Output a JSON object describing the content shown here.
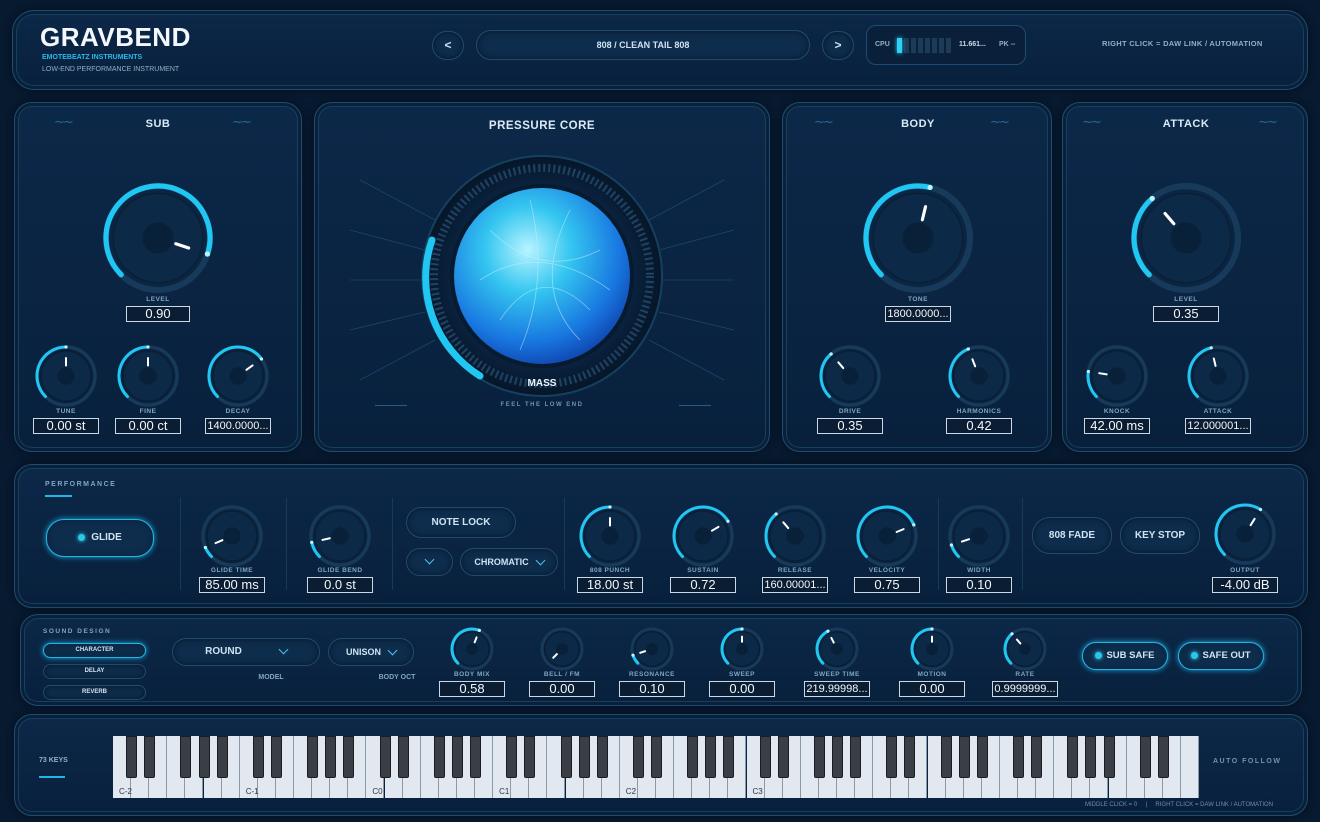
{
  "header": {
    "title": "GRAVBEND",
    "brand": "EMOTEBEATZ INSTRUMENTS",
    "tagline": "LOW-END PERFORMANCE INSTRUMENT",
    "prev_label": "<",
    "next_label": ">",
    "preset": "808  /  CLEAN TAIL 808",
    "cpu_label": "CPU",
    "cpu_value": "11.661...",
    "pk_label": "PK --",
    "hint": "RIGHT CLICK = DAW LINK / AUTOMATION"
  },
  "sub": {
    "title": "SUB",
    "level_label": "LEVEL",
    "level_value": "0.90",
    "tune_label": "TUNE",
    "tune_value": "0.00 st",
    "fine_label": "FINE",
    "fine_value": "0.00 ct",
    "decay_label": "DECAY",
    "decay_value": "1400.0000..."
  },
  "core": {
    "title": "PRESSURE CORE",
    "mass_label": "MASS",
    "subtitle": "FEEL THE LOW END"
  },
  "body": {
    "title": "BODY",
    "tone_label": "TONE",
    "tone_value": "1800.0000...",
    "drive_label": "DRIVE",
    "drive_value": "0.35",
    "harm_label": "HARMONICS",
    "harm_value": "0.42"
  },
  "attack": {
    "title": "ATTACK",
    "level_label": "LEVEL",
    "level_value": "0.35",
    "knock_label": "KNOCK",
    "knock_value": "42.00 ms",
    "attack_label": "ATTACK",
    "attack_value": "12.000001..."
  },
  "performance": {
    "title": "PERFORMANCE",
    "glide_label": "GLIDE",
    "glide_time_label": "GLIDE TIME",
    "glide_time_value": "85.00 ms",
    "glide_bend_label": "GLIDE BEND",
    "glide_bend_value": "0.0 st",
    "note_lock_label": "NOTE LOCK",
    "scale_label": "CHROMATIC",
    "punch_label": "808 PUNCH",
    "punch_value": "18.00 st",
    "sustain_label": "SUSTAIN",
    "sustain_value": "0.72",
    "release_label": "RELEASE",
    "release_value": "160.00001...",
    "velocity_label": "VELOCITY",
    "velocity_value": "0.75",
    "width_label": "WIDTH",
    "width_value": "0.10",
    "fade_label": "808 FADE",
    "keystop_label": "KEY STOP",
    "output_label": "OUTPUT",
    "output_value": "-4.00 dB"
  },
  "sound_design": {
    "title": "SOUND DESIGN",
    "tabs": [
      "CHARACTER",
      "DELAY",
      "REVERB"
    ],
    "model_value": "ROUND",
    "model_label": "MODEL",
    "bodyoct_value": "UNISON",
    "bodyoct_label": "BODY OCT",
    "body_mix_label": "BODY MIX",
    "body_mix_value": "0.58",
    "bell_label": "BELL / FM",
    "bell_value": "0.00",
    "res_label": "RESONANCE",
    "res_value": "0.10",
    "sweep_label": "SWEEP",
    "sweep_value": "0.00",
    "sweep_time_label": "SWEEP TIME",
    "sweep_time_value": "219.99998...",
    "motion_label": "MOTION",
    "motion_value": "0.00",
    "rate_label": "RATE",
    "rate_value": "0.9999999...",
    "sub_safe_label": "SUB SAFE",
    "safe_out_label": "SAFE OUT"
  },
  "keyboard": {
    "keys_label": "73 KEYS",
    "follow_label": "AUTO FOLLOW",
    "octave_labels": [
      "C-2",
      "C-1",
      "C0",
      "C1",
      "C2",
      "C3"
    ],
    "footer": "MIDDLE CLICK = 0     |     RIGHT CLICK = DAW LINK / AUTOMATION"
  },
  "knob_levels": {
    "sub_level": 0.9,
    "sub_tune": 0.5,
    "sub_fine": 0.5,
    "sub_decay": 0.7,
    "body_tone": 0.55,
    "body_drive": 0.35,
    "body_harm": 0.42,
    "atk_level": 0.35,
    "atk_knock": 0.2,
    "atk_attack": 0.45,
    "glide_time": 0.08,
    "glide_bend": 0.12,
    "punch": 0.5,
    "sustain": 0.72,
    "release": 0.35,
    "velocity": 0.75,
    "width": 0.1,
    "output": 0.62,
    "body_mix": 0.58,
    "bell": 0.0,
    "res": 0.1,
    "sweep": 0.5,
    "sweep_time": 0.4,
    "motion": 0.5,
    "rate": 0.35
  },
  "colors": {
    "accent": "#22b6e6",
    "arc": "#1fc7f2",
    "bg": "#081a30"
  }
}
